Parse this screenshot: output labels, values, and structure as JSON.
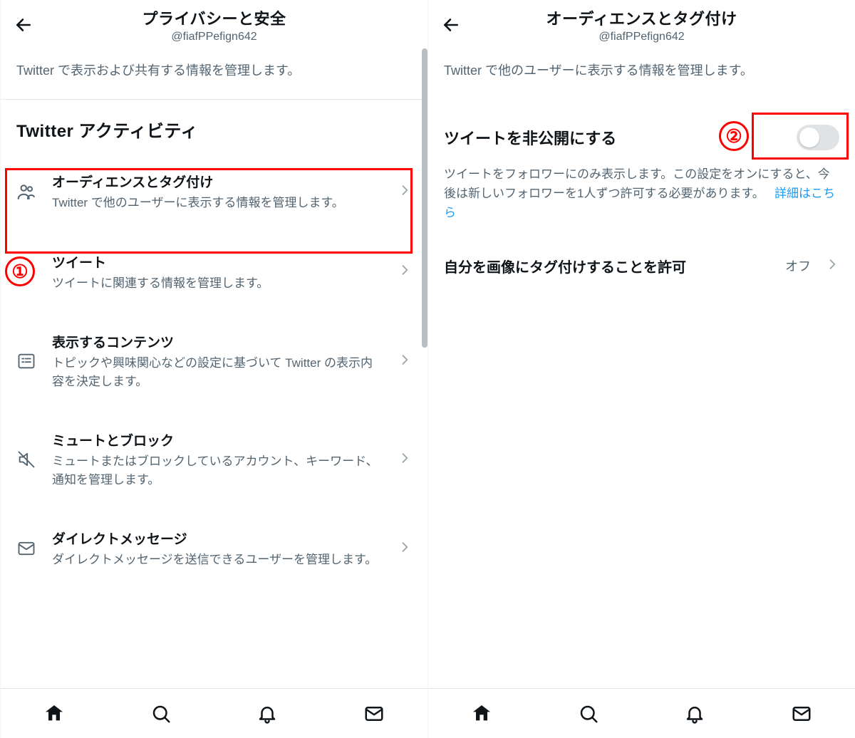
{
  "left": {
    "header": {
      "title": "プライバシーと安全",
      "handle": "@fiafPPefign642"
    },
    "intro": "Twitter で表示および共有する情報を管理します。",
    "section_title": "Twitter アクティビティ",
    "items": [
      {
        "label": "オーディエンスとタグ付け",
        "desc": "Twitter で他のユーザーに表示する情報を管理します。"
      },
      {
        "label": "ツイート",
        "desc": "ツイートに関連する情報を管理します。"
      },
      {
        "label": "表示するコンテンツ",
        "desc": "トピックや興味関心などの設定に基づいて Twitter の表示内容を決定します。"
      },
      {
        "label": "ミュートとブロック",
        "desc": "ミュートまたはブロックしているアカウント、キーワード、通知を管理します。"
      },
      {
        "label": "ダイレクトメッセージ",
        "desc": "ダイレクトメッセージを送信できるユーザーを管理します。"
      }
    ]
  },
  "right": {
    "header": {
      "title": "オーディエンスとタグ付け",
      "handle": "@fiafPPefign642"
    },
    "intro": "Twitter で他のユーザーに表示する情報を管理します。",
    "protect": {
      "label": "ツイートを非公開にする",
      "desc": "ツイートをフォロワーにのみ表示します。この設定をオンにすると、今後は新しいフォロワーを1人ずつ許可する必要があります。",
      "learn_more": "詳細はこちら"
    },
    "tagging": {
      "label": "自分を画像にタグ付けすることを許可",
      "value": "オフ"
    }
  },
  "annotations": {
    "one": "①",
    "two": "②"
  }
}
